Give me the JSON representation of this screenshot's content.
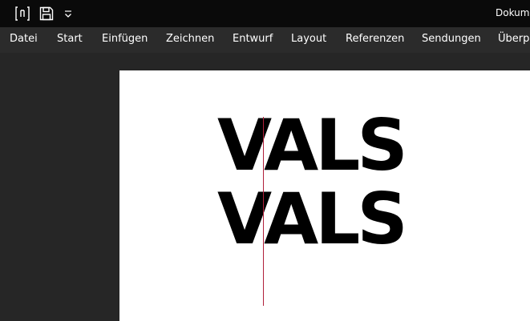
{
  "window": {
    "title": "Dokume"
  },
  "quick_access": [
    {
      "name": "autosave-icon"
    },
    {
      "name": "save-icon"
    },
    {
      "name": "customize-toolbar-icon"
    }
  ],
  "ribbon": {
    "tabs": [
      "Datei",
      "Start",
      "Einfügen",
      "Zeichnen",
      "Entwurf",
      "Layout",
      "Referenzen",
      "Sendungen",
      "Überpr"
    ]
  },
  "document": {
    "lines": [
      "VALS",
      "VALS"
    ],
    "guide_color": "#b0203a"
  },
  "colors": {
    "titlebar": "#0a0a0a",
    "ribbon": "#2b2b2b",
    "workspace": "#262626",
    "page": "#ffffff"
  }
}
